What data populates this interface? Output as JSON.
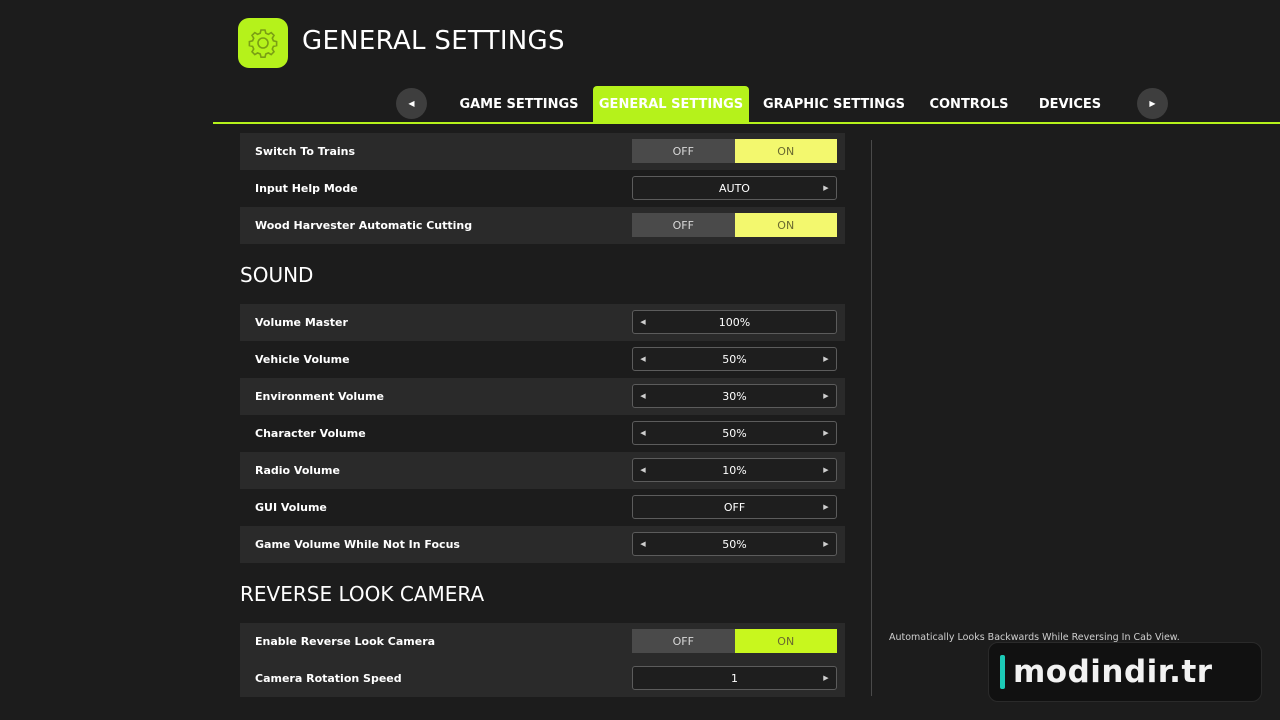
{
  "header": {
    "title": "GENERAL SETTINGS",
    "icon": "gear-icon",
    "accent_color": "#b5f21b"
  },
  "tabs": {
    "prev_icon": "◀",
    "next_icon": "▶",
    "items": [
      {
        "label": "GAME SETTINGS",
        "active": false
      },
      {
        "label": "GENERAL SETTINGS",
        "active": true
      },
      {
        "label": "GRAPHIC SETTINGS",
        "active": false
      },
      {
        "label": "CONTROLS",
        "active": false
      },
      {
        "label": "DEVICES",
        "active": false
      }
    ]
  },
  "settings": {
    "top_rows": [
      {
        "label": "Switch To Trains",
        "type": "toggle",
        "off": "OFF",
        "on": "ON",
        "selected": "ON"
      },
      {
        "label": "Input Help Mode",
        "type": "selector",
        "value": "AUTO"
      },
      {
        "label": "Wood Harvester Automatic Cutting",
        "type": "toggle",
        "off": "OFF",
        "on": "ON",
        "selected": "ON"
      }
    ],
    "sound": {
      "heading": "SOUND",
      "rows": [
        {
          "label": "Volume Master",
          "value": "100%"
        },
        {
          "label": "Vehicle Volume",
          "value": "50%"
        },
        {
          "label": "Environment Volume",
          "value": "30%"
        },
        {
          "label": "Character Volume",
          "value": "50%"
        },
        {
          "label": "Radio Volume",
          "value": "10%"
        },
        {
          "label": "GUI Volume",
          "value": "OFF"
        },
        {
          "label": "Game Volume While Not In Focus",
          "value": "50%"
        }
      ]
    },
    "reverse_camera": {
      "heading": "REVERSE LOOK CAMERA",
      "rows": [
        {
          "label": "Enable Reverse Look Camera",
          "type": "toggle",
          "off": "OFF",
          "on": "ON",
          "selected": "ON"
        },
        {
          "label": "Camera Rotation Speed",
          "type": "selector",
          "value": "1"
        }
      ]
    }
  },
  "selector_arrows": {
    "left": "◀",
    "right": "▶"
  },
  "help_panel": {
    "text": "Automatically Looks Backwards While Reversing In Cab View."
  },
  "watermark": {
    "text": "modindir.tr"
  }
}
